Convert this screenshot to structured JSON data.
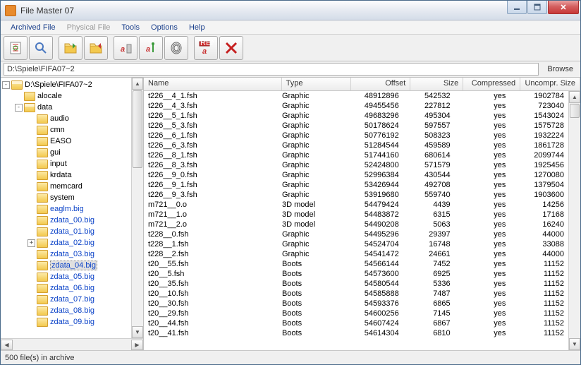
{
  "window": {
    "title": "File Master 07"
  },
  "menu": {
    "archived": "Archived File",
    "physical": "Physical File",
    "tools": "Tools",
    "options": "Options",
    "help": "Help"
  },
  "path": {
    "value": "D:\\Spiele\\FIFA07~2",
    "browse": "Browse"
  },
  "status": "500 file(s) in archive",
  "tree": {
    "root": "D:\\Spiele\\FIFA07~2",
    "nodes": [
      {
        "indent": 1,
        "exp": "",
        "ico": "folder-closed",
        "label": "alocale",
        "blue": false
      },
      {
        "indent": 1,
        "exp": "-",
        "ico": "folder-open",
        "label": "data",
        "blue": false
      },
      {
        "indent": 2,
        "exp": "",
        "ico": "folder-closed",
        "label": "audio",
        "blue": false
      },
      {
        "indent": 2,
        "exp": "",
        "ico": "folder-closed",
        "label": "cmn",
        "blue": false
      },
      {
        "indent": 2,
        "exp": "",
        "ico": "folder-closed",
        "label": "EASO",
        "blue": false
      },
      {
        "indent": 2,
        "exp": "",
        "ico": "folder-closed",
        "label": "gui",
        "blue": false
      },
      {
        "indent": 2,
        "exp": "",
        "ico": "folder-closed",
        "label": "input",
        "blue": false
      },
      {
        "indent": 2,
        "exp": "",
        "ico": "folder-closed",
        "label": "krdata",
        "blue": false
      },
      {
        "indent": 2,
        "exp": "",
        "ico": "folder-closed",
        "label": "memcard",
        "blue": false
      },
      {
        "indent": 2,
        "exp": "",
        "ico": "folder-closed",
        "label": "system",
        "blue": false
      },
      {
        "indent": 2,
        "exp": "",
        "ico": "file-ico",
        "label": "eaglm.big",
        "blue": true
      },
      {
        "indent": 2,
        "exp": "",
        "ico": "file-ico",
        "label": "zdata_00.big",
        "blue": true
      },
      {
        "indent": 2,
        "exp": "",
        "ico": "file-ico",
        "label": "zdata_01.big",
        "blue": true
      },
      {
        "indent": 2,
        "exp": "+",
        "ico": "file-ico",
        "label": "zdata_02.big",
        "blue": true
      },
      {
        "indent": 2,
        "exp": "",
        "ico": "file-ico",
        "label": "zdata_03.big",
        "blue": true
      },
      {
        "indent": 2,
        "exp": "",
        "ico": "file-ico",
        "label": "zdata_04.big",
        "blue": true,
        "selected": true
      },
      {
        "indent": 2,
        "exp": "",
        "ico": "file-ico",
        "label": "zdata_05.big",
        "blue": true
      },
      {
        "indent": 2,
        "exp": "",
        "ico": "file-ico",
        "label": "zdata_06.big",
        "blue": true
      },
      {
        "indent": 2,
        "exp": "",
        "ico": "file-ico",
        "label": "zdata_07.big",
        "blue": true
      },
      {
        "indent": 2,
        "exp": "",
        "ico": "file-ico",
        "label": "zdata_08.big",
        "blue": true
      },
      {
        "indent": 2,
        "exp": "",
        "ico": "file-ico",
        "label": "zdata_09.big",
        "blue": true
      }
    ]
  },
  "list": {
    "columns": {
      "name": "Name",
      "type": "Type",
      "offset": "Offset",
      "size": "Size",
      "compressed": "Compressed",
      "usize": "Uncompr. Size"
    },
    "rows": [
      {
        "name": "t226__4_1.fsh",
        "type": "Graphic",
        "offset": "48912896",
        "size": "542532",
        "compressed": "yes",
        "usize": "1902784"
      },
      {
        "name": "t226__4_3.fsh",
        "type": "Graphic",
        "offset": "49455456",
        "size": "227812",
        "compressed": "yes",
        "usize": "723040"
      },
      {
        "name": "t226__5_1.fsh",
        "type": "Graphic",
        "offset": "49683296",
        "size": "495304",
        "compressed": "yes",
        "usize": "1543024"
      },
      {
        "name": "t226__5_3.fsh",
        "type": "Graphic",
        "offset": "50178624",
        "size": "597557",
        "compressed": "yes",
        "usize": "1575728"
      },
      {
        "name": "t226__6_1.fsh",
        "type": "Graphic",
        "offset": "50776192",
        "size": "508323",
        "compressed": "yes",
        "usize": "1932224"
      },
      {
        "name": "t226__6_3.fsh",
        "type": "Graphic",
        "offset": "51284544",
        "size": "459589",
        "compressed": "yes",
        "usize": "1861728"
      },
      {
        "name": "t226__8_1.fsh",
        "type": "Graphic",
        "offset": "51744160",
        "size": "680614",
        "compressed": "yes",
        "usize": "2099744"
      },
      {
        "name": "t226__8_3.fsh",
        "type": "Graphic",
        "offset": "52424800",
        "size": "571579",
        "compressed": "yes",
        "usize": "1925456"
      },
      {
        "name": "t226__9_0.fsh",
        "type": "Graphic",
        "offset": "52996384",
        "size": "430544",
        "compressed": "yes",
        "usize": "1270080"
      },
      {
        "name": "t226__9_1.fsh",
        "type": "Graphic",
        "offset": "53426944",
        "size": "492708",
        "compressed": "yes",
        "usize": "1379504"
      },
      {
        "name": "t226__9_3.fsh",
        "type": "Graphic",
        "offset": "53919680",
        "size": "559740",
        "compressed": "yes",
        "usize": "1903600"
      },
      {
        "name": "m721__0.o",
        "type": "3D model",
        "offset": "54479424",
        "size": "4439",
        "compressed": "yes",
        "usize": "14256"
      },
      {
        "name": "m721__1.o",
        "type": "3D model",
        "offset": "54483872",
        "size": "6315",
        "compressed": "yes",
        "usize": "17168"
      },
      {
        "name": "m721__2.o",
        "type": "3D model",
        "offset": "54490208",
        "size": "5063",
        "compressed": "yes",
        "usize": "16240"
      },
      {
        "name": "t228__0.fsh",
        "type": "Graphic",
        "offset": "54495296",
        "size": "29397",
        "compressed": "yes",
        "usize": "44000"
      },
      {
        "name": "t228__1.fsh",
        "type": "Graphic",
        "offset": "54524704",
        "size": "16748",
        "compressed": "yes",
        "usize": "33088"
      },
      {
        "name": "t228__2.fsh",
        "type": "Graphic",
        "offset": "54541472",
        "size": "24661",
        "compressed": "yes",
        "usize": "44000"
      },
      {
        "name": "t20__55.fsh",
        "type": "Boots",
        "offset": "54566144",
        "size": "7452",
        "compressed": "yes",
        "usize": "11152"
      },
      {
        "name": "t20__5.fsh",
        "type": "Boots",
        "offset": "54573600",
        "size": "6925",
        "compressed": "yes",
        "usize": "11152"
      },
      {
        "name": "t20__35.fsh",
        "type": "Boots",
        "offset": "54580544",
        "size": "5336",
        "compressed": "yes",
        "usize": "11152"
      },
      {
        "name": "t20__10.fsh",
        "type": "Boots",
        "offset": "54585888",
        "size": "7487",
        "compressed": "yes",
        "usize": "11152"
      },
      {
        "name": "t20__30.fsh",
        "type": "Boots",
        "offset": "54593376",
        "size": "6865",
        "compressed": "yes",
        "usize": "11152"
      },
      {
        "name": "t20__29.fsh",
        "type": "Boots",
        "offset": "54600256",
        "size": "7145",
        "compressed": "yes",
        "usize": "11152"
      },
      {
        "name": "t20__44.fsh",
        "type": "Boots",
        "offset": "54607424",
        "size": "6867",
        "compressed": "yes",
        "usize": "11152"
      },
      {
        "name": "t20__41.fsh",
        "type": "Boots",
        "offset": "54614304",
        "size": "6810",
        "compressed": "yes",
        "usize": "11152"
      }
    ]
  }
}
